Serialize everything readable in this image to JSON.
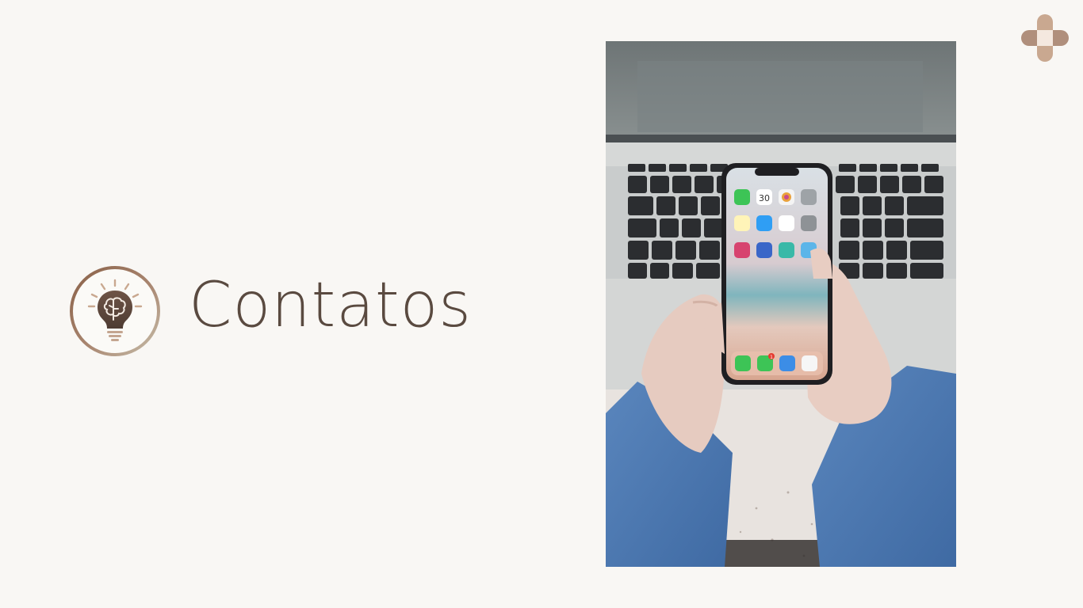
{
  "page": {
    "title": "Contatos"
  },
  "colors": {
    "background": "#f9f7f4",
    "title_text": "#5a4a40",
    "accent_tan": "#c9a890",
    "accent_brown": "#a37d66"
  },
  "icons": {
    "badge": "lightbulb-brain-icon",
    "corner": "plus-cross-icon"
  },
  "photo": {
    "subject": "hands-holding-smartphone-over-laptop",
    "phone_calendar_day": "30",
    "messages_badge_count": "1"
  }
}
